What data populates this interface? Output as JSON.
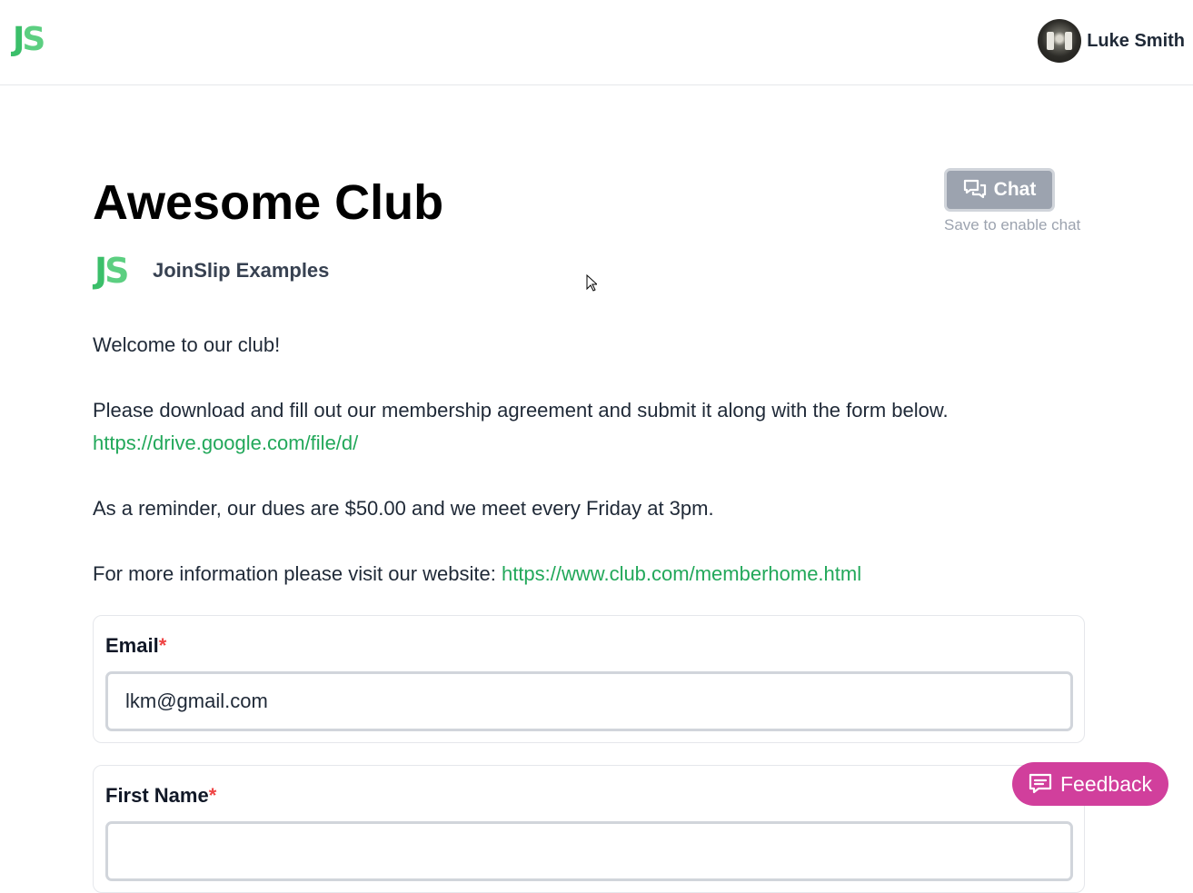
{
  "header": {
    "logo_text_j": "J",
    "logo_text_s": "S",
    "user_name": "Luke Smith"
  },
  "club": {
    "title": "Awesome Club",
    "org_logo_j": "J",
    "org_logo_s": "S",
    "org_name": "JoinSlip Examples"
  },
  "chat": {
    "label": "Chat",
    "hint": "Save to enable chat"
  },
  "description": {
    "welcome": "Welcome to our club!",
    "download_text": "Please download and fill out our membership agreement and submit it along with the form below.",
    "download_link": "https://drive.google.com/file/d/",
    "reminder": "As a reminder, our dues are $50.00 and we meet every Friday at 3pm.",
    "more_info_text": "For more information please visit our website: ",
    "more_info_link": "https://www.club.com/memberhome.html"
  },
  "form": {
    "email": {
      "label": "Email",
      "required_mark": "*",
      "value": "lkm@gmail.com"
    },
    "first_name": {
      "label": "First Name",
      "required_mark": "*",
      "value": ""
    }
  },
  "feedback": {
    "label": "Feedback"
  },
  "colors": {
    "brand_green": "#3bbf6a",
    "link_green": "#22a85a",
    "feedback_pink": "#d13f9c",
    "required_red": "#ef4444",
    "chat_disabled_gray": "#9ca3af"
  }
}
